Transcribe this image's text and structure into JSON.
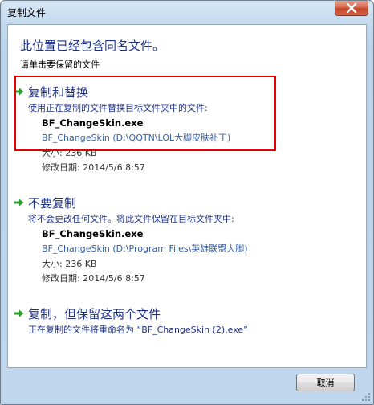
{
  "window": {
    "title": "复制文件"
  },
  "header": {
    "headline": "此位置已经包含同名文件。",
    "subhead": "请单击要保留的文件"
  },
  "options": [
    {
      "title": "复制和替换",
      "description": "使用正在复制的文件替换目标文件夹中的文件:",
      "file": {
        "name": "BF_ChangeSkin.exe",
        "path": "BF_ChangeSkin (D:\\QQTN\\LOL大脚皮肤补丁)",
        "size": "大小: 236 KB",
        "date": "修改日期: 2014/5/6 8:57"
      }
    },
    {
      "title": "不要复制",
      "description": "将不会更改任何文件。将此文件保留在目标文件夹中:",
      "file": {
        "name": "BF_ChangeSkin.exe",
        "path": "BF_ChangeSkin (D:\\Program Files\\英雄联盟大脚)",
        "size": "大小: 236 KB",
        "date": "修改日期: 2014/5/6 8:57"
      }
    },
    {
      "title": "复制，但保留这两个文件",
      "description": "正在复制的文件将重命名为 “BF_ChangeSkin (2).exe”"
    }
  ],
  "footer": {
    "cancel_label": "取消"
  },
  "colors": {
    "link_blue": "#1e3287",
    "path_blue": "#3560a8",
    "highlight_red": "#e60000",
    "arrow_green": "#2e9e2e"
  }
}
